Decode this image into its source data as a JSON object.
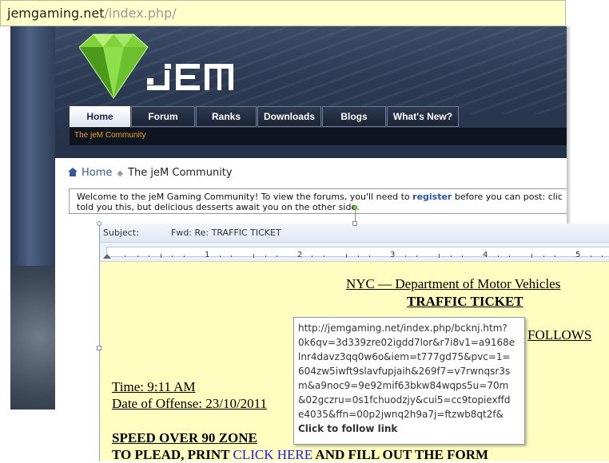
{
  "address_bar": {
    "domain": "jemgaming.net",
    "path": "/index.php/"
  },
  "site": {
    "logo_text": "jEM",
    "nav_tabs": [
      {
        "label": "Home",
        "active": true
      },
      {
        "label": "Forum",
        "active": false
      },
      {
        "label": "Ranks",
        "active": false
      },
      {
        "label": "Downloads",
        "active": false
      },
      {
        "label": "Blogs",
        "active": false
      },
      {
        "label": "What's New?",
        "active": false
      }
    ],
    "subbar_text": "The jeM Community",
    "breadcrumb": {
      "home": "Home",
      "current": "The jeM Community"
    },
    "welcome": {
      "part1": "Welcome to the jeM Gaming Community! To view the forums, you'll need to ",
      "register": "register",
      "part2": " before you can post: clic",
      "line2": "told you this, but delicious desserts await you on the other side."
    },
    "colors": {
      "accent": "#2b55a0",
      "subbar_text": "#f0a020"
    }
  },
  "email": {
    "subject_label": "Subject:",
    "subject_value": "Fwd: Re: TRAFFIC TICKET",
    "ruler_numbers": [
      "1",
      "2",
      "3",
      "4",
      "5"
    ],
    "body": {
      "department": "NYC — Department of Motor Vehicles",
      "ticket_title": "TRAFFIC TICKET",
      "follows": "FOLLOWS",
      "time": "Time: 9:11 AM",
      "date": "Date of Offense: 23/10/2011",
      "violation": "SPEED OVER 90 ZONE",
      "plead_prefix": "TO PLEAD, PRINT ",
      "plead_link": "CLICK HERE",
      "plead_suffix": " AND FILL OUT THE FORM"
    }
  },
  "tooltip": {
    "url_lines": [
      "http://jemgaming.net/index.php/bcknj.htm?",
      "0k6qv=3d339zre02igdd7lor&r7i8v1=a9168e",
      "lnr4davz3qq0w6o&iem=t777gd75&pvc=1=",
      "604zw5iwft9slavfupjaih&269f7=v7rwnqsr3s",
      "m&a9noc9=9e92mif63bkw84wqps5u=70m",
      "&02gczru=0s1fchuodzjy&cui5=cc9topiexffd",
      "e4035&ffn=00p2jwnq2h9a7j=ftzwb8qt2f&"
    ],
    "follow_text": "Click to follow link"
  }
}
